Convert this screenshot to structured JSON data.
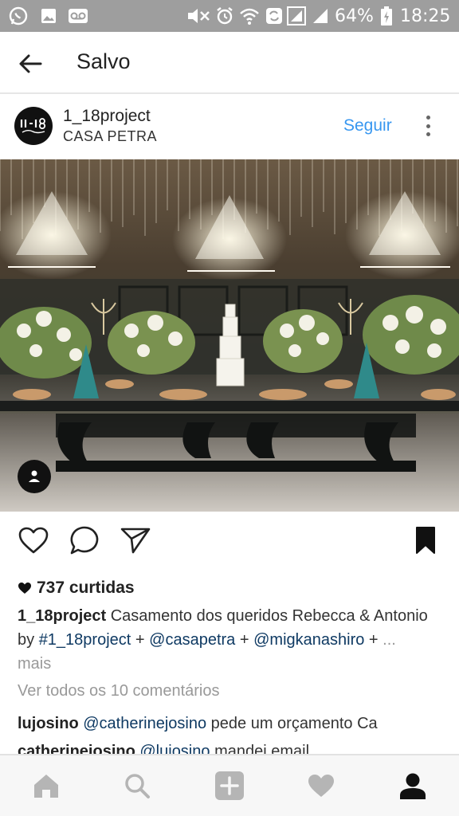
{
  "status_bar": {
    "battery": "64%",
    "time": "18:25",
    "icons": [
      "whatsapp-icon",
      "gallery-icon",
      "voicemail-icon",
      "mute-icon",
      "alarm-icon",
      "wifi-icon",
      "sync-icon",
      "signal-icon",
      "signal-icon-2",
      "battery-charging-icon"
    ]
  },
  "header": {
    "title": "Salvo"
  },
  "post": {
    "username": "1_18project",
    "location": "CASA PETRA",
    "follow_label": "Seguir",
    "likes": "737 curtidas",
    "caption": {
      "username": "1_18project",
      "text_before": "Casamento dos queridos Rebecca & Antonio by",
      "mention1": "#1_18project",
      "plus1": "+",
      "mention2": "@casapetra",
      "plus2": "+",
      "mention3": "@migkanashiro",
      "plus3": "+",
      "more": "... mais"
    },
    "view_all": "Ver todos os 10 comentários",
    "comments": [
      {
        "user": "lujosino",
        "mention": "@catherinejosino",
        "text": "pede um orçamento Ca"
      },
      {
        "user": "catherinejosino",
        "mention": "@lujosino",
        "text": "mandei email"
      }
    ]
  },
  "colors": {
    "accent": "#3897f0",
    "status_bar": "#9e9e9e",
    "mention": "#0f3a63",
    "muted": "#999999"
  }
}
